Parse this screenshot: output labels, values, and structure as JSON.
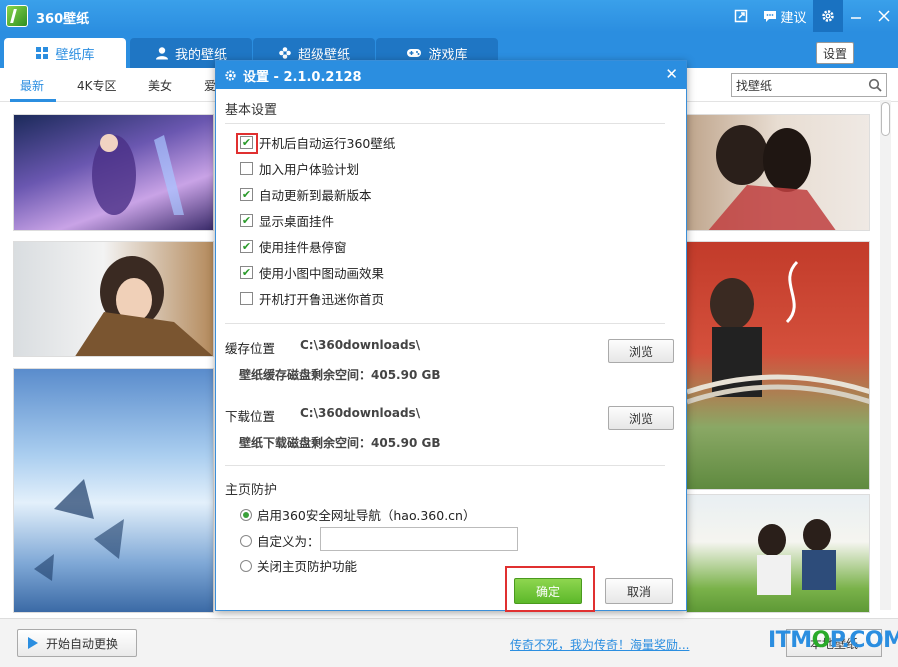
{
  "app": {
    "title": "360壁纸",
    "feedback_label": "建议"
  },
  "tabs": [
    {
      "label": "壁纸库",
      "icon": "grid-icon"
    },
    {
      "label": "我的壁纸",
      "icon": "user-icon"
    },
    {
      "label": "超级壁纸",
      "icon": "flower-icon"
    },
    {
      "label": "游戏库",
      "icon": "gamepad-icon"
    }
  ],
  "settings_button": "设置",
  "categories": [
    "最新",
    "4K专区",
    "美女",
    "爱"
  ],
  "search": {
    "value": "找壁纸"
  },
  "bottom": {
    "auto_change": "开始自动更换",
    "promo_link": "传奇不死，我为传奇！海量奖励...",
    "local_wallpaper": "本地壁纸"
  },
  "watermark": {
    "prefix": "ITM",
    "suffix": "P.COM"
  },
  "dialog": {
    "title": "设置 - 2.1.0.2128",
    "basic_section": "基本设置",
    "options": [
      {
        "label": "开机后自动运行360壁纸",
        "checked": true
      },
      {
        "label": "加入用户体验计划",
        "checked": false
      },
      {
        "label": "自动更新到最新版本",
        "checked": true
      },
      {
        "label": "显示桌面挂件",
        "checked": true
      },
      {
        "label": "使用挂件悬停窗",
        "checked": true
      },
      {
        "label": "使用小图中图动画效果",
        "checked": true
      },
      {
        "label": "开机打开鲁迅迷你首页",
        "checked": false
      }
    ],
    "cache": {
      "label": "缓存位置",
      "path": "C:\\360downloads\\",
      "free_space": "壁纸缓存磁盘剩余空间：405.90 GB",
      "browse": "浏览"
    },
    "download": {
      "label": "下载位置",
      "path": "C:\\360downloads\\",
      "free_space": "壁纸下载磁盘剩余空间：405.90 GB",
      "browse": "浏览"
    },
    "homepage_section": "主页防护",
    "homepage_options": [
      {
        "label": "启用360安全网址导航（hao.360.cn）",
        "selected": true
      },
      {
        "label": "自定义为：",
        "selected": false
      },
      {
        "label": "关闭主页防护功能",
        "selected": false
      }
    ],
    "custom_url_value": "",
    "ok": "确定",
    "cancel": "取消"
  }
}
